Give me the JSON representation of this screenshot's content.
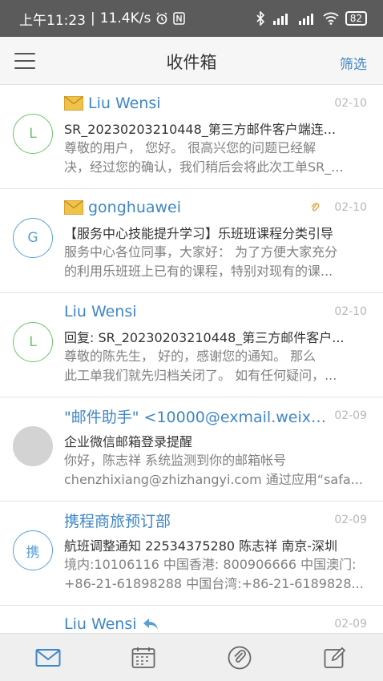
{
  "status_bar": {
    "time": "上午11:23",
    "separator": "|",
    "net_speed": "11.4K/s",
    "battery": "82"
  },
  "header": {
    "title": "收件箱",
    "filter_label": "筛选"
  },
  "mails": [
    {
      "avatar": "L",
      "sender": "Liu Wensi",
      "date": "02-10",
      "subject": "SR_20230203210448_第三方邮件客户端连...",
      "preview_line1": "尊敬的用户，  您好。 很高兴您的问题已经解",
      "preview_line2": "决，经过您的确认，我们稍后会将此次工单SR_..."
    },
    {
      "avatar": "G",
      "sender": "gonghuawei",
      "date": "02-10",
      "subject": "【服务中心技能提升学习】乐班班课程分类引导",
      "preview_line1": "服务中心各位同事，大家好：  为了方便大家充分",
      "preview_line2": "的利用乐班班上已有的课程，特别对现有的课..."
    },
    {
      "avatar": "L",
      "sender": "Liu Wensi",
      "date": "02-10",
      "subject": "回复: SR_20230203210448_第三方邮件客户...",
      "preview_line1": "尊敬的陈先生，  好的，感谢您的通知。 那么",
      "preview_line2": "此工单我们就先归档关闭了。 如有任何疑问，..."
    },
    {
      "avatar": "",
      "sender": "\"邮件助手\" <10000@exmail.weixi...",
      "date": "02-09",
      "subject": "企业微信邮箱登录提醒",
      "preview_line1": "你好，陈志祥 系统监测到你的邮箱帐号",
      "preview_line2": "chenzhixiang@zhizhangyi.com 通过应用“safa..."
    },
    {
      "avatar": "携",
      "sender": "携程商旅预订部",
      "date": "02-09",
      "subject": "航班调整通知 22534375280 陈志祥 南京-深圳",
      "preview_line1": "境内:10106116 中国香港: 800906666 中国澳门:",
      "preview_line2": "+86-21-61898288 中国台湾:+86-21-6189828..."
    },
    {
      "avatar": "",
      "sender": "Liu Wensi",
      "date": "02-09",
      "subject": "",
      "preview_line1": "",
      "preview_line2": ""
    }
  ],
  "colors": {
    "accent": "#3f86c7",
    "avatar_green": "#6cc36c",
    "avatar_blue": "#5aa0d6",
    "envelope": "#f0c24a"
  },
  "icons": {
    "unread": "envelope-icon",
    "attachment": "paperclip-icon",
    "replied": "reply-arrow-icon",
    "tabs": [
      "mail-icon",
      "calendar-icon",
      "attachment-icon",
      "compose-icon"
    ]
  }
}
